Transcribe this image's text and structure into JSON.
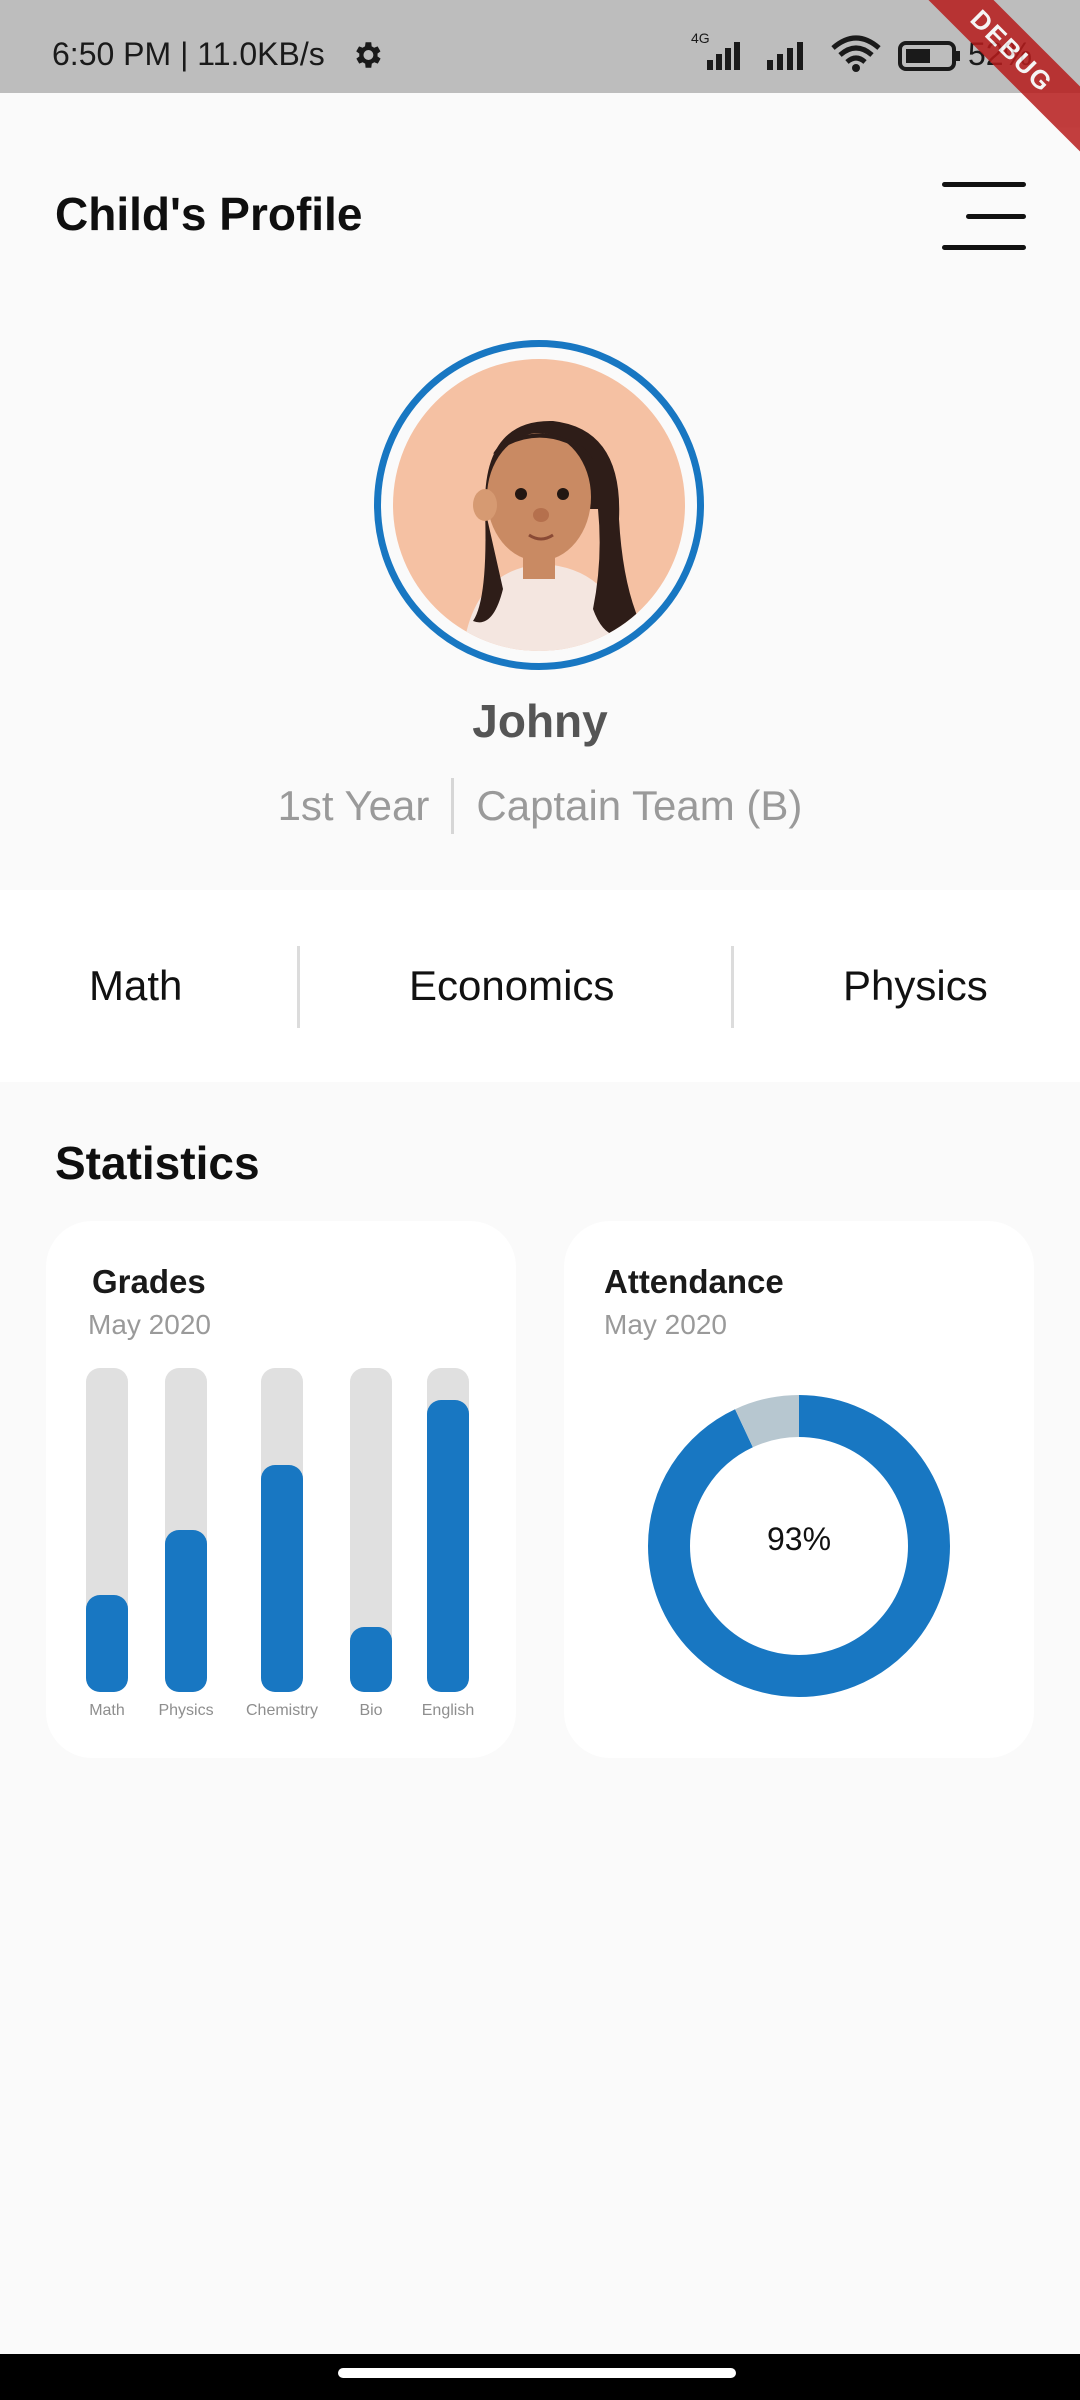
{
  "status_bar": {
    "time_network": "6:50 PM | 11.0KB/s",
    "network_type": "4G",
    "battery": "52%",
    "icons": [
      "gear-icon",
      "signal-icon",
      "signal-icon",
      "wifi-icon",
      "battery-icon"
    ]
  },
  "debug_banner": "DEBUG",
  "header": {
    "title": "Child's Profile",
    "menu_icon": "menu-icon"
  },
  "profile": {
    "name": "Johny",
    "year": "1st Year",
    "role": "Captain Team (B)"
  },
  "subjects": [
    "Math",
    "Economics",
    "Physics"
  ],
  "statistics": {
    "title": "Statistics",
    "grades": {
      "title": "Grades",
      "period": "May 2020"
    },
    "attendance": {
      "title": "Attendance",
      "period": "May 2020",
      "label": "93%"
    }
  },
  "colors": {
    "accent": "#1877c2",
    "track": "#e0e0e0",
    "donut_remainder": "#b7c7d0"
  },
  "chart_data": [
    {
      "type": "bar",
      "title": "Grades",
      "subtitle": "May 2020",
      "categories": [
        "Math",
        "Physics",
        "Chemistry",
        "Bio",
        "English"
      ],
      "values": [
        30,
        50,
        70,
        20,
        90
      ],
      "ylim": [
        0,
        100
      ],
      "grid": false
    },
    {
      "type": "pie",
      "title": "Attendance",
      "subtitle": "May 2020",
      "values": [
        93,
        7
      ],
      "center_label": "93%"
    }
  ]
}
